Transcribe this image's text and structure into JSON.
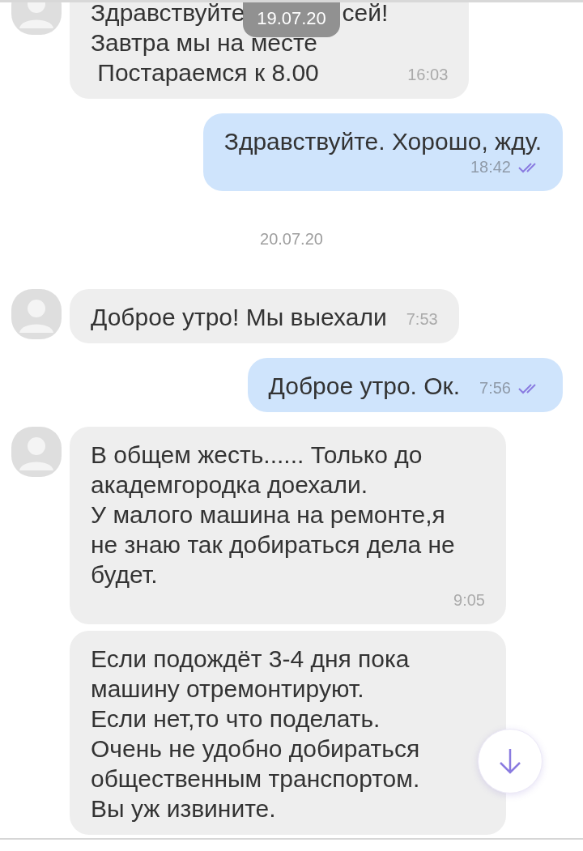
{
  "date_badge": "19.07.20",
  "messages": [
    {
      "kind": "incoming",
      "avatar": true,
      "lines": [
        [
          "Здравствуйте",
          "сей!"
        ],
        [
          "Завтра мы на месте"
        ],
        [
          " Постараемся к 8.00"
        ]
      ],
      "time": "16:03"
    },
    {
      "kind": "outgoing",
      "lines": [
        [
          "Здравствуйте. Хорошо, жду."
        ]
      ],
      "time": "18:42",
      "read": true
    },
    {
      "kind": "date",
      "text": "20.07.20"
    },
    {
      "kind": "incoming",
      "avatar": true,
      "lines": [
        [
          "Доброе утро! Мы выехали"
        ]
      ],
      "time": "7:53"
    },
    {
      "kind": "outgoing",
      "lines": [
        [
          "Доброе утро. Ок."
        ]
      ],
      "time": "7:56",
      "read": true
    },
    {
      "kind": "incoming",
      "avatar": true,
      "lines": [
        [
          "В общем жесть...... Только до"
        ],
        [
          "академгородка доехали."
        ],
        [
          "У малого машина на ремонте,я"
        ],
        [
          "не знаю так добираться дела не"
        ],
        [
          "будет."
        ]
      ],
      "time": "9:05"
    },
    {
      "kind": "incoming",
      "avatar": false,
      "lines": [
        [
          "Если подождёт 3-4 дня пока"
        ],
        [
          "машину отремонтируют."
        ],
        [
          "Если нет,то что поделать."
        ],
        [
          "Очень не удобно добираться"
        ],
        [
          "общественным транспортом."
        ],
        [
          "Вы уж извините."
        ]
      ]
    }
  ]
}
